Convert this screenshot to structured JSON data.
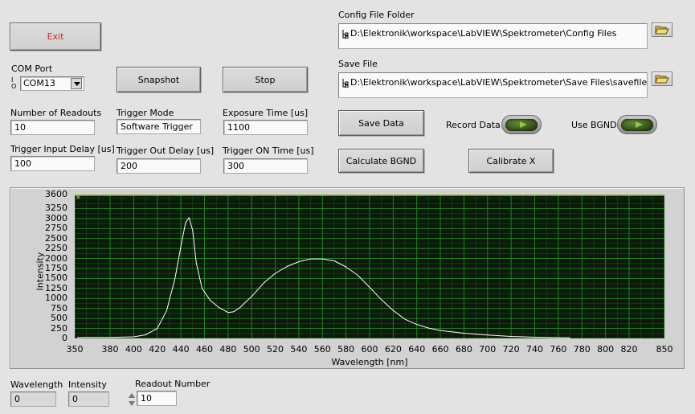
{
  "buttons": {
    "exit": "Exit",
    "snapshot": "Snapshot",
    "stop": "Stop",
    "save_data": "Save Data",
    "calculate_bgnd": "Calculate BGND",
    "calibrate_x": "Calibrate X"
  },
  "com_port": {
    "label": "COM Port",
    "value": "COM13",
    "prefix": "I/O"
  },
  "config_folder": {
    "label": "Config File Folder",
    "path": "D:\\Elektronik\\workspace\\LabVIEW\\Spektrometer\\Config Files"
  },
  "save_file": {
    "label": "Save File",
    "path": "D:\\Elektronik\\workspace\\LabVIEW\\Spektrometer\\Save Files\\savefile.txt"
  },
  "fields": {
    "num_readouts": {
      "label": "Number of Readouts",
      "value": "10"
    },
    "trigger_mode": {
      "label": "Trigger Mode",
      "value": "Software Trigger"
    },
    "exposure_time": {
      "label": "Exposure Time [us]",
      "value": "1100"
    },
    "trigger_input_delay": {
      "label": "Trigger Input Delay [us]",
      "value": "100"
    },
    "trigger_out_delay": {
      "label": "Trigger Out Delay [us]",
      "value": "200"
    },
    "trigger_on_time": {
      "label": "Trigger ON Time [us]",
      "value": "300"
    }
  },
  "toggles": {
    "record_data": {
      "label": "Record Data",
      "state": "on"
    },
    "use_bgnd": {
      "label": "Use BGND",
      "state": "on"
    }
  },
  "indicators": {
    "wavelength": {
      "label": "Wavelength",
      "value": "0"
    },
    "intensity": {
      "label": "Intensity",
      "value": "0"
    },
    "readout_number": {
      "label": "Readout Number",
      "value": "10"
    }
  },
  "colors": {
    "plot_bg": "#0b1a0b",
    "grid": "#1f8a1f",
    "trace": "#ffffff",
    "exit_text": "#e0202a"
  },
  "chart_data": {
    "type": "line",
    "xlabel": "Wavelength [nm]",
    "ylabel": "Intensity",
    "xlim": [
      350,
      850
    ],
    "ylim": [
      0,
      3600
    ],
    "x_ticks": [
      350,
      380,
      400,
      420,
      440,
      460,
      480,
      500,
      520,
      540,
      560,
      580,
      600,
      620,
      640,
      660,
      680,
      700,
      720,
      740,
      760,
      780,
      800,
      820,
      850
    ],
    "y_ticks": [
      0,
      250,
      500,
      750,
      1000,
      1250,
      1500,
      1750,
      2000,
      2250,
      2500,
      2750,
      3000,
      3250,
      3600
    ],
    "y_tick_labels": [
      0,
      250,
      500,
      750,
      1000,
      1250,
      1500,
      1750,
      2000,
      2250,
      2500,
      2750,
      3000,
      3250,
      3600
    ],
    "x_tick_labels": [
      350,
      380,
      400,
      420,
      440,
      460,
      480,
      500,
      520,
      540,
      560,
      580,
      600,
      620,
      640,
      660,
      680,
      700,
      720,
      740,
      760,
      780,
      800,
      820,
      850
    ],
    "grid": true,
    "series": [
      {
        "x": [
          352,
          360,
          380,
          400,
          410,
          420,
          428,
          435,
          440,
          444,
          447,
          450,
          453,
          458,
          465,
          472,
          480,
          485,
          490,
          500,
          510,
          520,
          530,
          540,
          550,
          560,
          570,
          580,
          590,
          600,
          610,
          620,
          630,
          640,
          650,
          660,
          680,
          700,
          720,
          740,
          760,
          770
        ],
        "y": [
          20,
          25,
          25,
          40,
          90,
          250,
          700,
          1500,
          2300,
          2900,
          3020,
          2700,
          1900,
          1250,
          950,
          780,
          650,
          670,
          770,
          1050,
          1380,
          1630,
          1800,
          1920,
          1990,
          1990,
          1940,
          1790,
          1580,
          1280,
          970,
          700,
          480,
          350,
          260,
          200,
          130,
          85,
          50,
          30,
          20,
          15
        ]
      }
    ]
  }
}
